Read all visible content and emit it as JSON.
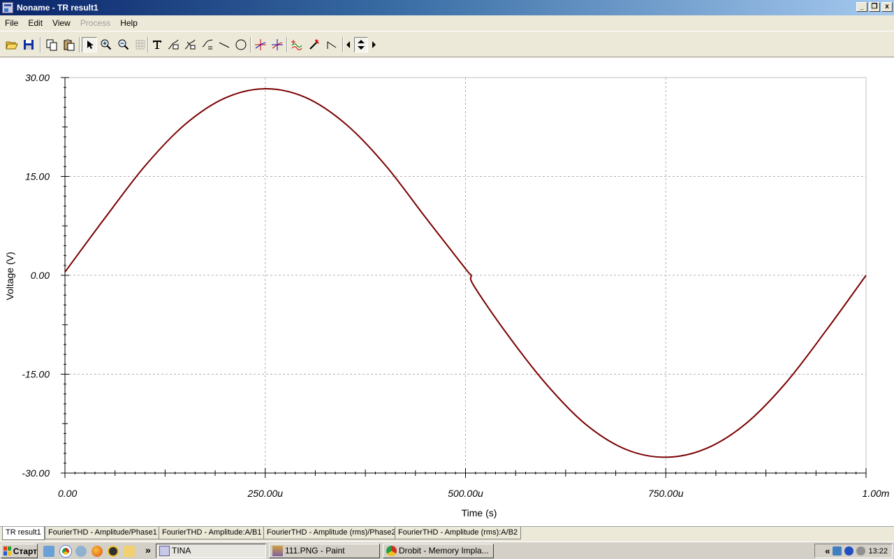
{
  "window": {
    "title": "Noname - TR result1",
    "controls": [
      "_",
      "❐",
      "x"
    ]
  },
  "menu": {
    "items": [
      {
        "label": "File",
        "enabled": true
      },
      {
        "label": "Edit",
        "enabled": true
      },
      {
        "label": "View",
        "enabled": true
      },
      {
        "label": "Process",
        "enabled": false
      },
      {
        "label": "Help",
        "enabled": true
      }
    ]
  },
  "toolbar": {
    "buttons": [
      "open-icon",
      "save-icon",
      "copy-icon",
      "paste-icon",
      "select-arrow-icon",
      "zoom-in-icon",
      "zoom-out-icon",
      "grid-icon",
      "text-icon",
      "curve-label-icon",
      "curve-label-2-icon",
      "legend-icon",
      "line-icon",
      "circle-icon",
      "cursor-a-icon",
      "cursor-b-icon",
      "curves-icon",
      "probe-icon",
      "step-icon",
      "arrow-left-icon",
      "arrow-up-down-icon",
      "arrow-right-icon"
    ]
  },
  "chart_data": {
    "type": "line",
    "xlabel": "Time (s)",
    "ylabel": "Voltage (V)",
    "xlim": [
      0,
      0.001
    ],
    "ylim": [
      -30,
      30
    ],
    "x_ticks": [
      "0.00",
      "250.00u",
      "500.00u",
      "750.00u",
      "1.00m"
    ],
    "y_ticks": [
      "30.00",
      "15.00",
      "0.00",
      "-15.00",
      "-30.00"
    ],
    "grid": true,
    "series": [
      {
        "color": "#7a0000",
        "x": [
          0,
          5e-05,
          0.0001,
          0.00015,
          0.0002,
          0.00025,
          0.0003,
          0.00035,
          0.0004,
          0.00045,
          0.0005,
          0.000507,
          0.00051,
          0.00055,
          0.0006,
          0.00065,
          0.0007,
          0.00075,
          0.0008,
          0.00085,
          0.0009,
          0.00095,
          0.001
        ],
        "y": [
          0.5,
          8.7,
          16.6,
          22.9,
          26.9,
          28.3,
          27.0,
          23.0,
          16.7,
          8.8,
          1.0,
          0.0,
          -1.5,
          -8.6,
          -16.4,
          -22.6,
          -26.4,
          -27.6,
          -26.3,
          -22.5,
          -16.3,
          -8.4,
          0.0
        ]
      }
    ]
  },
  "tabs": [
    {
      "label": "TR result1",
      "active": true
    },
    {
      "label": "FourierTHD - Amplitude/Phase1",
      "active": false
    },
    {
      "label": "FourierTHD - Amplitude:A/B1",
      "active": false
    },
    {
      "label": "FourierTHD - Amplitude (rms)/Phase2",
      "active": false
    },
    {
      "label": "FourierTHD - Amplitude (rms):A/B2",
      "active": false
    }
  ],
  "taskbar": {
    "start_label": "Старт",
    "more_label": "»",
    "tasks": [
      {
        "label": "TINA",
        "active": true
      },
      {
        "label": "111.PNG - Paint",
        "active": false
      },
      {
        "label": "Drobit - Memory Impla...",
        "active": false
      }
    ],
    "tray_expand": "«",
    "clock": "13:22"
  }
}
